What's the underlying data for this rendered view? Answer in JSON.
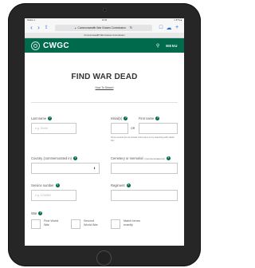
{
  "status_bar": {
    "left": "Station ✈",
    "time": "10:32",
    "right": "✦ 87% ■"
  },
  "browser": {
    "back_icon": "chevron-left-icon",
    "url": "Commonwealth War Graves Commission",
    "tab_title": "Commonwealth War Graves Commission"
  },
  "header": {
    "logo_text": "CWGC",
    "menu_label": "MENU"
  },
  "page": {
    "title": "FIND WAR DEAD",
    "how_to_search": "How To Search"
  },
  "form": {
    "last_name": {
      "label": "Last name",
      "placeholder": "e.g. Smith"
    },
    "initials": {
      "label": "Initial(s)"
    },
    "or_label": "OR",
    "first_name": {
      "label": "First name"
    },
    "first_name_note": "Some records do not include a first name so try searching with initials first",
    "country": {
      "label": "Country (commemorated in)",
      "value": ""
    },
    "cemetery": {
      "label": "Cemetery or memorial",
      "label_small": "(commemorated at)"
    },
    "service_number": {
      "label": "Service number",
      "placeholder": "e.g. 1234567"
    },
    "regiment": {
      "label": "Regiment"
    },
    "war": {
      "label": "War"
    },
    "first_world_war": {
      "label": "First World War"
    },
    "second_world_war": {
      "label": "Second World War"
    },
    "match_exactly": {
      "label": "Match terms exactly"
    }
  }
}
